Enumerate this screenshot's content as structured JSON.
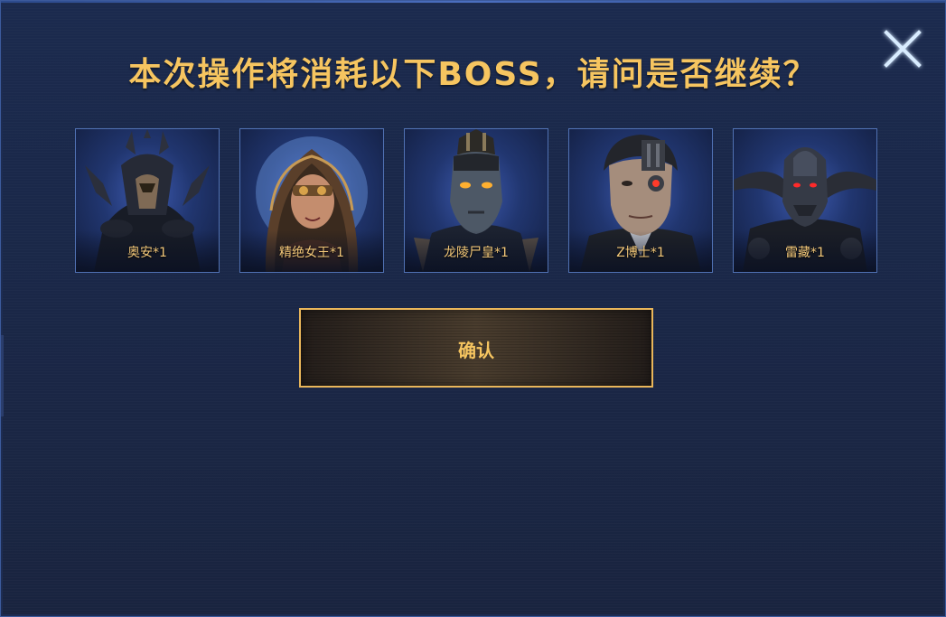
{
  "dialog": {
    "title": "本次操作将消耗以下BOSS，请问是否继续？",
    "close_icon": "close-icon",
    "confirm_label": "确认"
  },
  "bosses": [
    {
      "label": "奥安*1",
      "icon": "boss-portrait-aoan"
    },
    {
      "label": "精绝女王*1",
      "icon": "boss-portrait-jingjue-queen"
    },
    {
      "label": "龙陵尸皇*1",
      "icon": "boss-portrait-longling-corpse-emperor"
    },
    {
      "label": "Z博士*1",
      "icon": "boss-portrait-dr-z"
    },
    {
      "label": "雷藏*1",
      "icon": "boss-portrait-leizang"
    }
  ],
  "colors": {
    "background": "#1a2647",
    "accent_gold": "#f6c560",
    "card_border": "#5071b3",
    "close_icon": "#d8ecff"
  }
}
